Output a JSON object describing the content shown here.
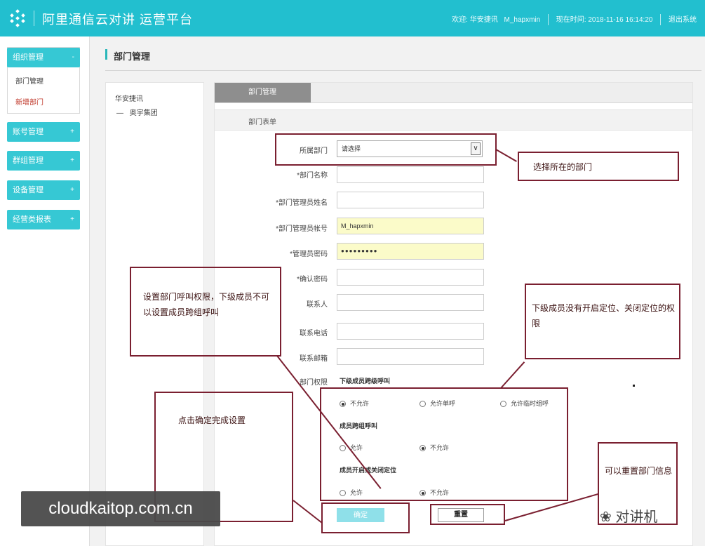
{
  "header": {
    "app_title": "阿里通信云对讲 运营平台",
    "welcome_text": "欢迎: 华安捷讯",
    "username": "M_hapxmin",
    "current_time": "现在时间: 2018-11-16 16:14:20",
    "logout_label": "退出系统"
  },
  "sidebar": {
    "groups": [
      {
        "label": "组织管理",
        "chevron": "-",
        "expanded": true
      },
      {
        "label": "账号管理",
        "chevron": "+"
      },
      {
        "label": "群组管理",
        "chevron": "+"
      },
      {
        "label": "设备管理",
        "chevron": "+"
      },
      {
        "label": "经营类报表",
        "chevron": "+"
      }
    ],
    "submenu": [
      {
        "label": "部门管理",
        "active": false
      },
      {
        "label": "新增部门",
        "active": true
      }
    ]
  },
  "page": {
    "title": "部门管理"
  },
  "tree": {
    "root": "华安捷讯",
    "child_prefix": "—",
    "child": "奥宇集团"
  },
  "tabs": [
    {
      "label": "部门管理"
    }
  ],
  "section": {
    "label": "部门表单"
  },
  "form": {
    "parent_dept_label": "所属部门",
    "parent_dept_value": "请选择",
    "dept_name_label": "*部门名称",
    "admin_name_label": "*部门管理员姓名",
    "admin_account_label": "*部门管理员帐号",
    "admin_account_value": "M_hapxmin",
    "admin_password_label": "*管理员密码",
    "admin_password_value": "●●●●●●●●●",
    "confirm_password_label": "*确认密码",
    "contact_label": "联系人",
    "phone_label": "联系电话",
    "email_label": "联系邮箱",
    "permission_label": "部门权限",
    "perm_groups": [
      {
        "title": "下级成员跨级呼叫",
        "options": [
          {
            "label": "不允许",
            "checked": true
          },
          {
            "label": "允许单呼",
            "checked": false
          },
          {
            "label": "允许临时组呼",
            "checked": false
          }
        ]
      },
      {
        "title": "成员跨组呼叫",
        "options": [
          {
            "label": "允许",
            "checked": false
          },
          {
            "label": "不允许",
            "checked": true
          }
        ]
      },
      {
        "title": "成员开启或关闭定位",
        "options": [
          {
            "label": "允许",
            "checked": false
          },
          {
            "label": "不允许",
            "checked": true
          }
        ]
      }
    ],
    "confirm_button": "确定",
    "reset_button": "重置"
  },
  "annotations": {
    "select_dept": "选择所在的部门",
    "call_permission": "设置部门呼叫权限，下级成员不可以设置成员跨组呼叫",
    "location_permission": "下级成员没有开启定位、关闭定位的权限",
    "click_confirm": "点击确定完成设置",
    "reset_info": "可以重置部门信息"
  },
  "watermark": {
    "text": "cloudkaitop.com.cn",
    "logo_text": "对讲机"
  },
  "colors": {
    "header_bg": "#22bfcf",
    "menu_bg": "#36c8d4",
    "annotation": "#7a1f30"
  }
}
